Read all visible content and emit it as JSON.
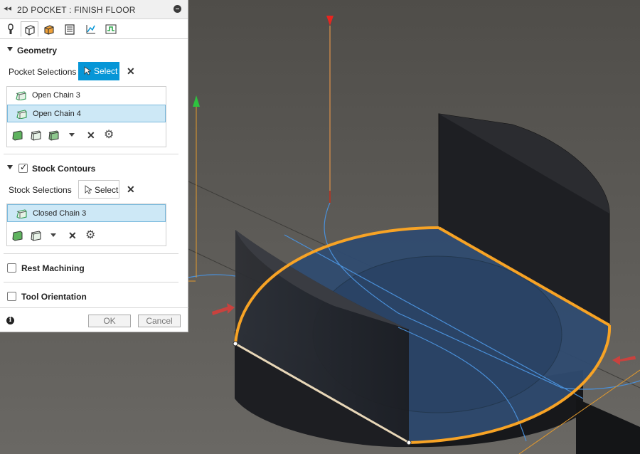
{
  "panel": {
    "title": "2D POCKET : FINISH FLOOR",
    "collapse_icon": "double-left-arrow-icon",
    "minimize_icon": "minus-circle-icon",
    "tabs": [
      {
        "name": "tool-tab",
        "icon": "tool-icon"
      },
      {
        "name": "geometry-tab",
        "icon": "geometry-cube-icon",
        "active": true
      },
      {
        "name": "heights-tab",
        "icon": "heights-icon"
      },
      {
        "name": "passes-tab",
        "icon": "passes-icon"
      },
      {
        "name": "linking-tab",
        "icon": "linking-icon"
      },
      {
        "name": "simulation-tab",
        "icon": "simulation-icon"
      }
    ],
    "geometry": {
      "heading": "Geometry",
      "pocket_selections_label": "Pocket Selections",
      "select_label": "Select",
      "items": [
        "Open Chain 3",
        "Open Chain 4"
      ],
      "selected_index": 1
    },
    "stock": {
      "heading": "Stock Contours",
      "checked": true,
      "stock_selections_label": "Stock Selections",
      "select_label": "Select",
      "items": [
        "Closed Chain 3"
      ],
      "selected_index": 0
    },
    "rest_machining": {
      "label": "Rest Machining",
      "checked": false
    },
    "tool_orientation": {
      "label": "Tool Orientation",
      "checked": false
    },
    "footer": {
      "ok_label": "OK",
      "cancel_label": "Cancel"
    }
  },
  "colors": {
    "accent": "#0696d7",
    "selection_highlight": "#cde8f6",
    "chain_orange": "#f7a325",
    "viewport_bg": "#5b5955",
    "pocket_blue": "#2f4b70"
  }
}
